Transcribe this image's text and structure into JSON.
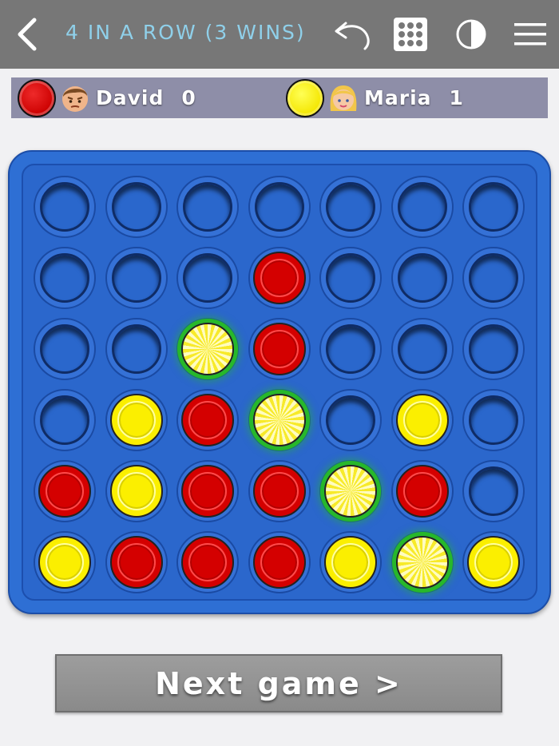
{
  "header": {
    "title": "4 IN A ROW (3 WINS)",
    "icons": [
      "chevron-left-icon",
      "undo-icon",
      "grid-icon",
      "contrast-icon",
      "menu-icon"
    ]
  },
  "players": [
    {
      "name": "David",
      "score": "0",
      "chip": "red",
      "avatar": "boy-avatar-icon"
    },
    {
      "name": "Maria",
      "score": "1",
      "chip": "yellow",
      "avatar": "girl-avatar-icon"
    }
  ],
  "board": {
    "rows": 6,
    "cols": 7,
    "cells": [
      [
        "",
        "",
        "",
        "",
        "",
        "",
        ""
      ],
      [
        "",
        "",
        "",
        "R",
        "",
        "",
        ""
      ],
      [
        "",
        "",
        "Y*",
        "R",
        "",
        "",
        ""
      ],
      [
        "",
        "Y",
        "R",
        "Y*",
        "",
        "Y",
        ""
      ],
      [
        "R",
        "Y",
        "R",
        "R",
        "Y*",
        "R",
        ""
      ],
      [
        "Y",
        "R",
        "R",
        "R",
        "Y",
        "Y*",
        "Y"
      ]
    ],
    "legend": {
      "R": "red",
      "Y": "yellow",
      "*": "winning"
    }
  },
  "colors": {
    "topbar": "#777777",
    "title": "#8fd0ea",
    "scorebar": "#8e8ea8",
    "board": "#2e6fd4",
    "red": "#d40000",
    "yellow": "#fbef00",
    "win_glow": "#27b82a"
  },
  "actions": {
    "next_game_label": "Next game >"
  }
}
